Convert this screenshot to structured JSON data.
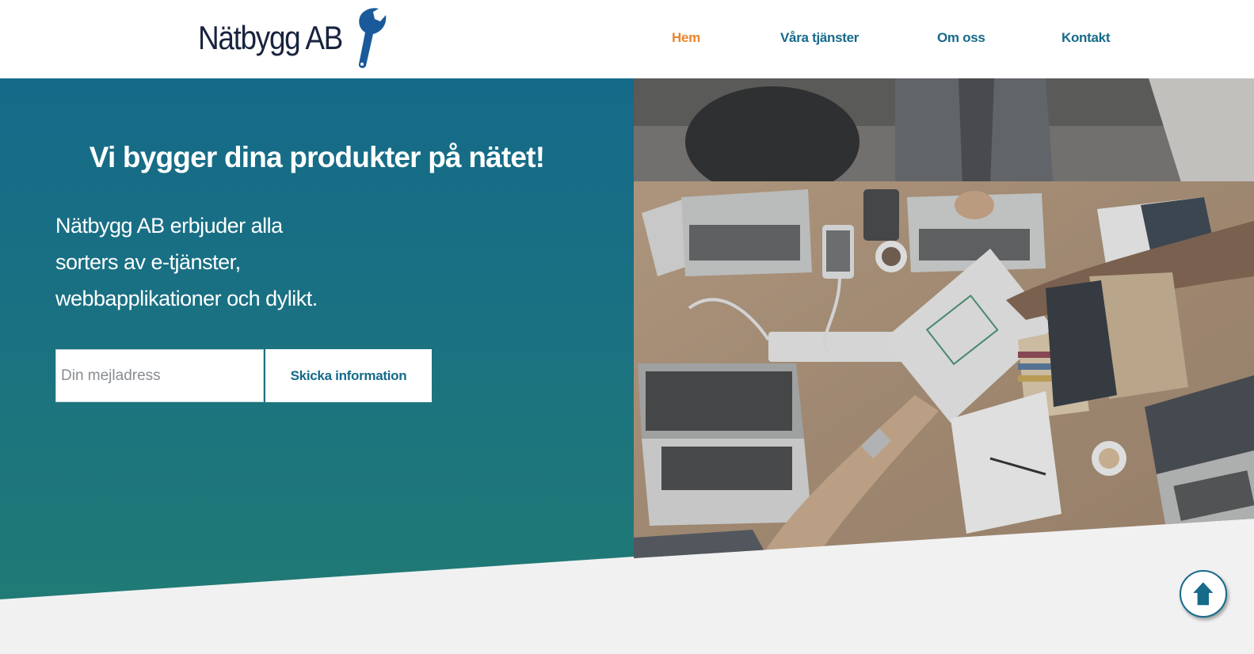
{
  "brand": {
    "name": "Nätbygg AB",
    "logo_icon": "wrench-icon",
    "logo_text_color": "#18233f",
    "logo_icon_color": "#1a5a9a"
  },
  "nav": {
    "items": [
      {
        "label": "Hem",
        "active": true
      },
      {
        "label": "Våra tjänster",
        "active": false
      },
      {
        "label": "Om oss",
        "active": false
      },
      {
        "label": "Kontakt",
        "active": false
      }
    ]
  },
  "hero": {
    "title": "Vi bygger dina produkter på nätet!",
    "lines": [
      "Nätbygg AB erbjuder alla",
      "sorters av e-tjänster,",
      "webbapplikationer och dylikt."
    ],
    "email_placeholder": "Din mejladress",
    "email_value": "",
    "submit_label": "Skicka information",
    "image_icon": "office-desk-laptops-photo"
  },
  "scroll_top": {
    "icon": "arrow-up-icon"
  },
  "colors": {
    "accent": "#e8852e",
    "primary": "#166a8a",
    "hero_top": "#156a89",
    "hero_bottom": "#207a75",
    "page_bg": "#f1f1f2"
  }
}
